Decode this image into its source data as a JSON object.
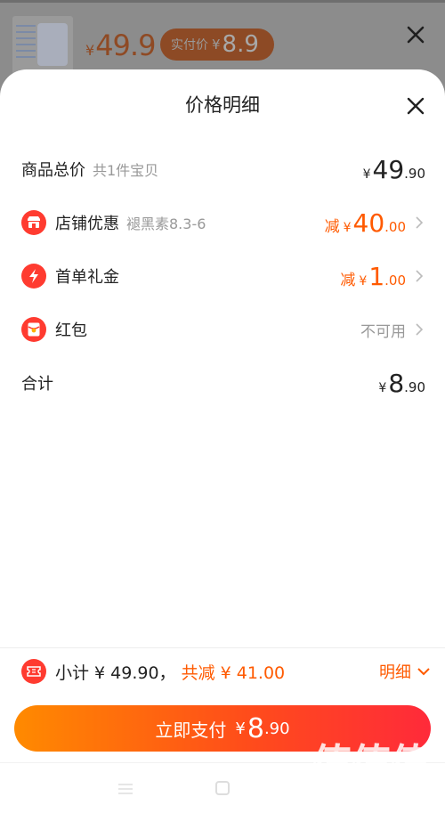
{
  "background": {
    "price": {
      "currency": "¥",
      "value": "49.9"
    },
    "pay_pill": {
      "label": "实付价",
      "currency": "¥",
      "value": "8.9"
    }
  },
  "sheet": {
    "title": "价格明细",
    "rows": [
      {
        "name": "商品总价",
        "sub": "共1件宝贝",
        "currency": "¥",
        "int": "49",
        "dec": ".90"
      },
      {
        "name": "店铺优惠",
        "sub": "褪黑素8.3-6",
        "prefix": "减",
        "currency": "¥",
        "int": "40",
        "dec": ".00",
        "icon": "shop-icon"
      },
      {
        "name": "首单礼金",
        "prefix": "减",
        "currency": "¥",
        "int": "1",
        "dec": ".00",
        "icon": "lightning-icon"
      },
      {
        "name": "红包",
        "status": "不可用",
        "icon": "red-envelope-icon"
      },
      {
        "name": "合计",
        "currency": "¥",
        "int": "8",
        "dec": ".90"
      }
    ]
  },
  "footer": {
    "subtotal": "小计 ¥ 49.90，",
    "reduced": "共减 ¥ 41.00",
    "detail_label": "明细",
    "pay_button": {
      "label": "立即支付",
      "currency": "¥",
      "int": "8",
      "dec": ".90"
    }
  },
  "watermark": {
    "glyphs": "值值值",
    "url": "zhizhizhi.com"
  },
  "colors": {
    "accent": "#ff5a00",
    "icon_red": "#ff3b30",
    "pay_start": "#ff8a00",
    "pay_end": "#ff2a3a"
  }
}
